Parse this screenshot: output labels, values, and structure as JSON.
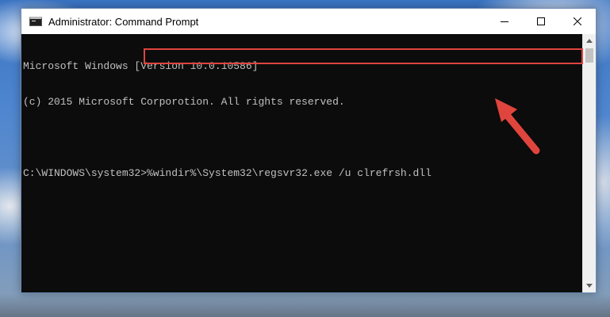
{
  "window": {
    "title": "Administrator: Command Prompt"
  },
  "console": {
    "lines": [
      "Microsoft Windows [Version 10.0.10586]",
      "(c) 2015 Microsoft Corporotion. All rights reserved."
    ],
    "prompt": "C:\\WINDOWS\\system32>",
    "command": "%windir%\\System32\\regsvr32.exe /u clrefrsh.dll"
  },
  "colors": {
    "console_bg": "#0c0c0c",
    "console_text": "#c0c0c0",
    "highlight": "#e0443e",
    "arrow": "#e0443e"
  },
  "icons": {
    "app": "cmd-icon",
    "minimize": "minimize-icon",
    "maximize": "maximize-icon",
    "close": "close-icon",
    "scroll_up": "scroll-up-icon",
    "scroll_down": "scroll-down-icon",
    "annotation": "red-arrow-icon"
  }
}
